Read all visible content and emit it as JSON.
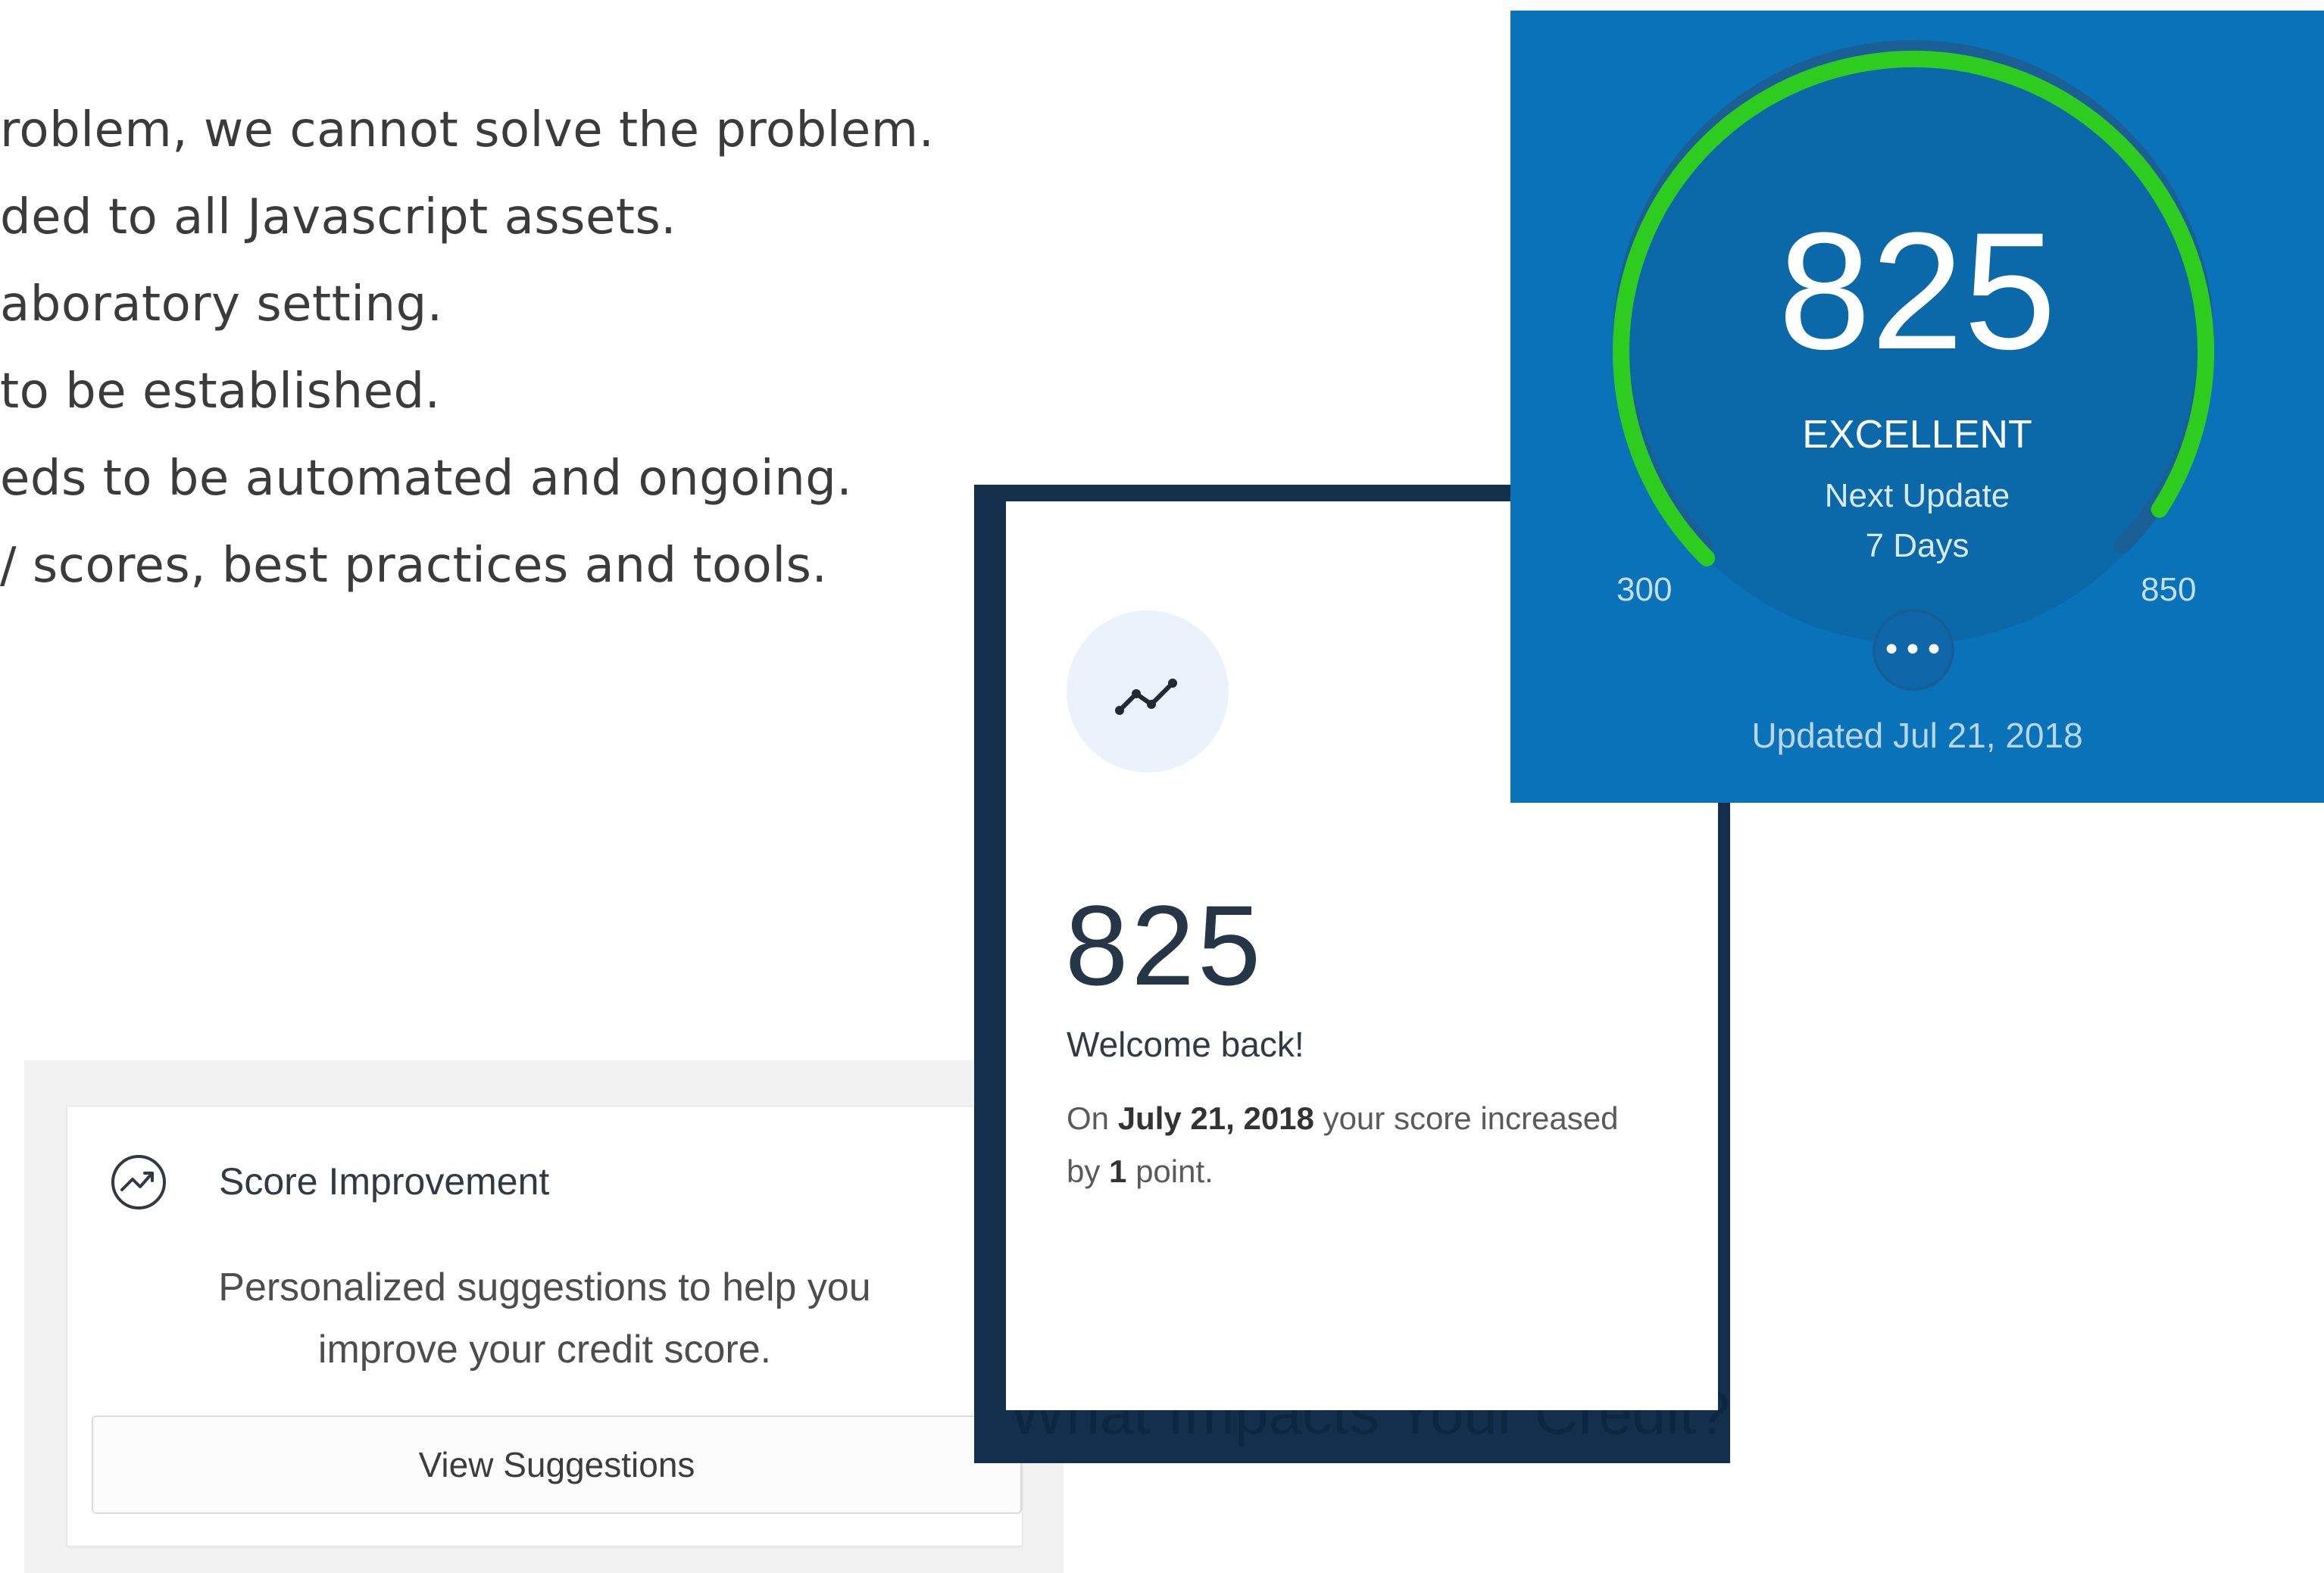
{
  "slide_text": {
    "lines": [
      "roblem, we cannot solve the problem.",
      "ded to all Javascript assets.",
      "aboratory setting.",
      "to be established.",
      "eds to be automated and ongoing.",
      "/ scores, best practices and tools."
    ]
  },
  "score_improvement": {
    "icon": "trend-up-circle-icon",
    "title": "Score Improvement",
    "description_line1": "Personalized suggestions to help you",
    "description_line2": "improve your credit score.",
    "button_label": "View Suggestions"
  },
  "score_summary": {
    "icon": "trend-line-icon",
    "score": "825",
    "greeting": "Welcome back!",
    "update_prefix": "On",
    "update_date": "July 21, 2018",
    "update_mid": "your score increased by",
    "update_points": "1",
    "update_suffix": "point.",
    "background_heading": "What Impacts Your Credit?"
  },
  "credit_gauge": {
    "score": "825",
    "rating": "EXCELLENT",
    "next_update_label": "Next Update",
    "next_update_value": "7 Days",
    "min": "300",
    "max": "850",
    "menu_icon": "more-dots-icon",
    "updated": "Updated Jul 21, 2018",
    "colors": {
      "background": "#0a72b8",
      "arc": "#2ecc1f",
      "track": "#1a5f95"
    }
  }
}
